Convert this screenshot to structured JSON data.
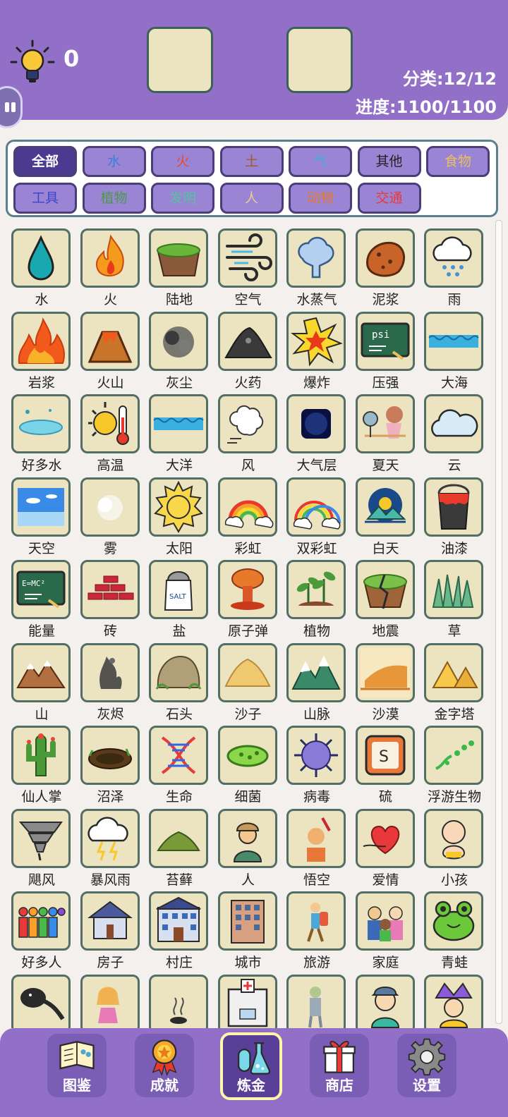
{
  "header": {
    "hint_count": "0",
    "category_stat": "分类:12/12",
    "progress_stat": "进度:1100/1100"
  },
  "categories": [
    {
      "label": "全部",
      "color": "#ffffff"
    },
    {
      "label": "水",
      "color": "#3a7ed8"
    },
    {
      "label": "火",
      "color": "#e84a2a"
    },
    {
      "label": "土",
      "color": "#a05a2a"
    },
    {
      "label": "气",
      "color": "#4aa8d8"
    },
    {
      "label": "其他",
      "color": "#222222"
    },
    {
      "label": "食物",
      "color": "#e8c060"
    },
    {
      "label": "工具",
      "color": "#3a48c8"
    },
    {
      "label": "植物",
      "color": "#4a9a4a"
    },
    {
      "label": "发明",
      "color": "#5ac0a0"
    },
    {
      "label": "人",
      "color": "#f0c890"
    },
    {
      "label": "动物",
      "color": "#e8782a"
    },
    {
      "label": "交通",
      "color": "#e83a3a"
    }
  ],
  "elements": [
    {
      "label": "水",
      "icon": "water-drop-icon"
    },
    {
      "label": "火",
      "icon": "fire-icon"
    },
    {
      "label": "陆地",
      "icon": "land-icon"
    },
    {
      "label": "空气",
      "icon": "air-icon"
    },
    {
      "label": "水蒸气",
      "icon": "steam-icon"
    },
    {
      "label": "泥浆",
      "icon": "mud-icon"
    },
    {
      "label": "雨",
      "icon": "rain-icon"
    },
    {
      "label": "岩浆",
      "icon": "lava-icon"
    },
    {
      "label": "火山",
      "icon": "volcano-icon"
    },
    {
      "label": "灰尘",
      "icon": "dust-icon"
    },
    {
      "label": "火药",
      "icon": "gunpowder-icon"
    },
    {
      "label": "爆炸",
      "icon": "explosion-icon"
    },
    {
      "label": "压强",
      "icon": "pressure-board-icon"
    },
    {
      "label": "大海",
      "icon": "sea-icon"
    },
    {
      "label": "好多水",
      "icon": "puddle-icon"
    },
    {
      "label": "高温",
      "icon": "heat-icon"
    },
    {
      "label": "大洋",
      "icon": "ocean-icon"
    },
    {
      "label": "风",
      "icon": "wind-icon"
    },
    {
      "label": "大气层",
      "icon": "atmosphere-icon"
    },
    {
      "label": "夏天",
      "icon": "summer-icon"
    },
    {
      "label": "云",
      "icon": "cloud-icon"
    },
    {
      "label": "天空",
      "icon": "sky-icon"
    },
    {
      "label": "雾",
      "icon": "fog-icon"
    },
    {
      "label": "太阳",
      "icon": "sun-icon"
    },
    {
      "label": "彩虹",
      "icon": "rainbow-icon"
    },
    {
      "label": "双彩虹",
      "icon": "double-rainbow-icon"
    },
    {
      "label": "白天",
      "icon": "daytime-icon"
    },
    {
      "label": "油漆",
      "icon": "paint-bucket-icon"
    },
    {
      "label": "能量",
      "icon": "energy-board-icon"
    },
    {
      "label": "砖",
      "icon": "brick-icon"
    },
    {
      "label": "盐",
      "icon": "salt-shaker-icon"
    },
    {
      "label": "原子弹",
      "icon": "atomic-bomb-icon"
    },
    {
      "label": "植物",
      "icon": "plant-icon"
    },
    {
      "label": "地震",
      "icon": "earthquake-icon"
    },
    {
      "label": "草",
      "icon": "grass-icon"
    },
    {
      "label": "山",
      "icon": "mountain-icon"
    },
    {
      "label": "灰烬",
      "icon": "ash-icon"
    },
    {
      "label": "石头",
      "icon": "stone-icon"
    },
    {
      "label": "沙子",
      "icon": "sand-icon"
    },
    {
      "label": "山脉",
      "icon": "mountain-range-icon"
    },
    {
      "label": "沙漠",
      "icon": "desert-icon"
    },
    {
      "label": "金字塔",
      "icon": "pyramid-icon"
    },
    {
      "label": "仙人掌",
      "icon": "cactus-icon"
    },
    {
      "label": "沼泽",
      "icon": "swamp-icon"
    },
    {
      "label": "生命",
      "icon": "dna-icon"
    },
    {
      "label": "细菌",
      "icon": "bacteria-icon"
    },
    {
      "label": "病毒",
      "icon": "virus-icon"
    },
    {
      "label": "硫",
      "icon": "sulfur-icon"
    },
    {
      "label": "浮游生物",
      "icon": "plankton-icon"
    },
    {
      "label": "飓风",
      "icon": "tornado-icon"
    },
    {
      "label": "暴风雨",
      "icon": "storm-icon"
    },
    {
      "label": "苔藓",
      "icon": "moss-icon"
    },
    {
      "label": "人",
      "icon": "person-icon"
    },
    {
      "label": "悟空",
      "icon": "wukong-icon"
    },
    {
      "label": "爱情",
      "icon": "love-icon"
    },
    {
      "label": "小孩",
      "icon": "baby-icon"
    },
    {
      "label": "好多人",
      "icon": "crowd-icon"
    },
    {
      "label": "房子",
      "icon": "house-icon"
    },
    {
      "label": "村庄",
      "icon": "village-icon"
    },
    {
      "label": "城市",
      "icon": "city-icon"
    },
    {
      "label": "旅游",
      "icon": "traveler-icon"
    },
    {
      "label": "家庭",
      "icon": "family-icon"
    },
    {
      "label": "青蛙",
      "icon": "frog-icon"
    },
    {
      "label": "",
      "icon": "tadpole-icon"
    },
    {
      "label": "",
      "icon": "girl-icon"
    },
    {
      "label": "",
      "icon": "smoke-icon"
    },
    {
      "label": "",
      "icon": "hospital-icon"
    },
    {
      "label": "",
      "icon": "zombie-icon"
    },
    {
      "label": "",
      "icon": "painter-icon"
    },
    {
      "label": "",
      "icon": "jester-icon"
    }
  ],
  "nav": [
    {
      "label": "图鉴",
      "icon": "book-icon"
    },
    {
      "label": "成就",
      "icon": "medal-icon"
    },
    {
      "label": "炼金",
      "icon": "flask-icon"
    },
    {
      "label": "商店",
      "icon": "gift-icon"
    },
    {
      "label": "设置",
      "icon": "gear-icon"
    }
  ],
  "colors": {
    "header": "#9270c8",
    "tile_bg": "#ece3c0",
    "tile_border": "#556e65",
    "active_tab": "#4a3a90"
  }
}
